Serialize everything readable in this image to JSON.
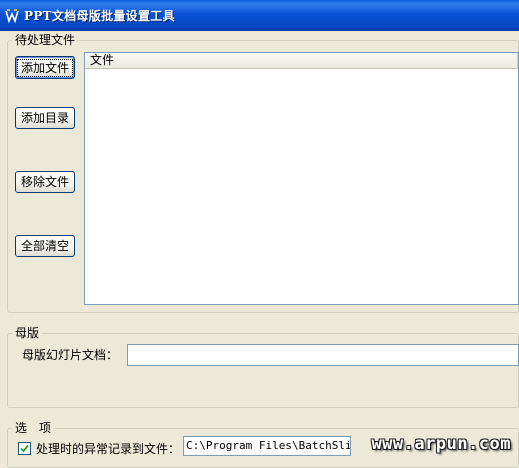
{
  "window": {
    "title": "PPT文档母版批量设置工具"
  },
  "pending_files": {
    "group_label": "待处理文件",
    "buttons": {
      "add_file": "添加文件",
      "add_dir": "添加目录",
      "remove_file": "移除文件",
      "clear_all": "全部清空"
    },
    "list": {
      "columns": [
        "文件"
      ],
      "rows": []
    }
  },
  "master": {
    "group_label": "母版",
    "doc_label": "母版幻灯片文档：",
    "doc_value": ""
  },
  "options": {
    "group_label": "选　项",
    "log_errors": {
      "label": "处理时的异常记录到文件：",
      "checked": true,
      "path": "C:\\Program Files\\BatchSlide"
    }
  },
  "watermark": "www.arpun.com",
  "colors": {
    "titlebar": "#0a53d6",
    "face": "#ece9d8",
    "border": "#7f9db9"
  }
}
